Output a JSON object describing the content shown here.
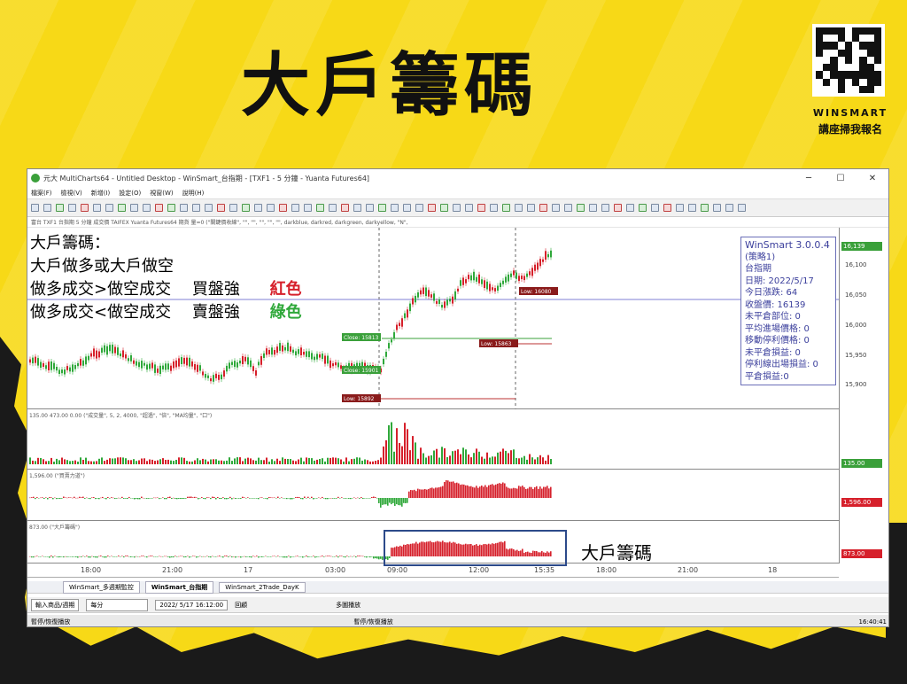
{
  "headline": "大戶籌碼",
  "qr": {
    "label_en": "WINSMART",
    "label_zh": "講座掃我報名"
  },
  "window": {
    "title": "元大 MultiCharts64 - Untitled Desktop - WinSmart_台指期 - [TXF1 - 5 分鐘 - Yuanta Futures64]",
    "controls": [
      "─",
      "☐",
      "✕"
    ],
    "menu": [
      "檔案(F)",
      "檢視(V)",
      "新增(I)",
      "設定(O)",
      "視窗(W)",
      "說明(H)"
    ],
    "chart_header": "富台 TXF1 台指期 5 分鐘 成交價 TAIFEX Yuanta Futures64 期貨 量=0 (\"關鍵價收線\", \"\", \"\", \"\", \"\", \"\", darkblue, darkred, darkgreen, darkyellow, \"N\","
  },
  "overlay": {
    "line1": "大戶籌碼：",
    "line2": "大戶做多或大戶做空",
    "line3a": "做多成交>做空成交",
    "line3b": "買盤強",
    "line3c": "紅色",
    "line4a": "做多成交<做空成交",
    "line4b": "賣盤強",
    "line4c": "綠色"
  },
  "infobox": {
    "lines": [
      "WinSmart 3.0.0.4",
      "(策略1)",
      "台指期",
      "日期: 2022/5/17",
      "今日漲跌: 64",
      "收盤價: 16139",
      "未平倉部位: 0",
      "平均進場價格: 0",
      "移動停利價格: 0",
      "未平倉損益: 0",
      "停利線出場損益: 0",
      "平倉損益:0"
    ]
  },
  "price_panel": {
    "ticks": [
      "16,100",
      "16,050",
      "16,000",
      "15,950",
      "15,900"
    ],
    "last_tag": "16,139",
    "labels": [
      "Low: 15863",
      "Low: 15892",
      "Close: 15813",
      "Close: 15901",
      "Low: 16080"
    ]
  },
  "volume_panel": {
    "header": "135.00 473.00 0.00 (\"成交量\", 5, 2, 4000, \"超過\", \"倍\", \"MA均量\", \"口\")",
    "tag": "135.00"
  },
  "buypower_panel": {
    "header": "1,596.00 (\"買賣力道\")",
    "tag": "1,596.00"
  },
  "whale_panel": {
    "header": "873.00 (\"大戶籌碼\")",
    "tag": "873.00"
  },
  "callout": "大戶籌碼",
  "xaxis": [
    "18:00",
    "21:00",
    "17",
    "03:00",
    "09:00",
    "12:00",
    "15:35",
    "18:00",
    "21:00",
    "18"
  ],
  "sheets": [
    "WinSmart_多週期監控",
    "WinSmart_台指期",
    "WinSmart_2Trade_DayK"
  ],
  "bottombar": {
    "symbol": "輸入商品/週期",
    "period": "每分",
    "datetime": "2022/ 5/17 16:12:00",
    "play": "回顧",
    "speed_label": "多圖播放"
  },
  "status": {
    "left": "暫停/恢復播放",
    "center": "暫停/恢復播放",
    "time": "16:40:41"
  },
  "colors": {
    "up": "#d6202b",
    "down": "#2fa83a",
    "background": "#f7d917"
  }
}
